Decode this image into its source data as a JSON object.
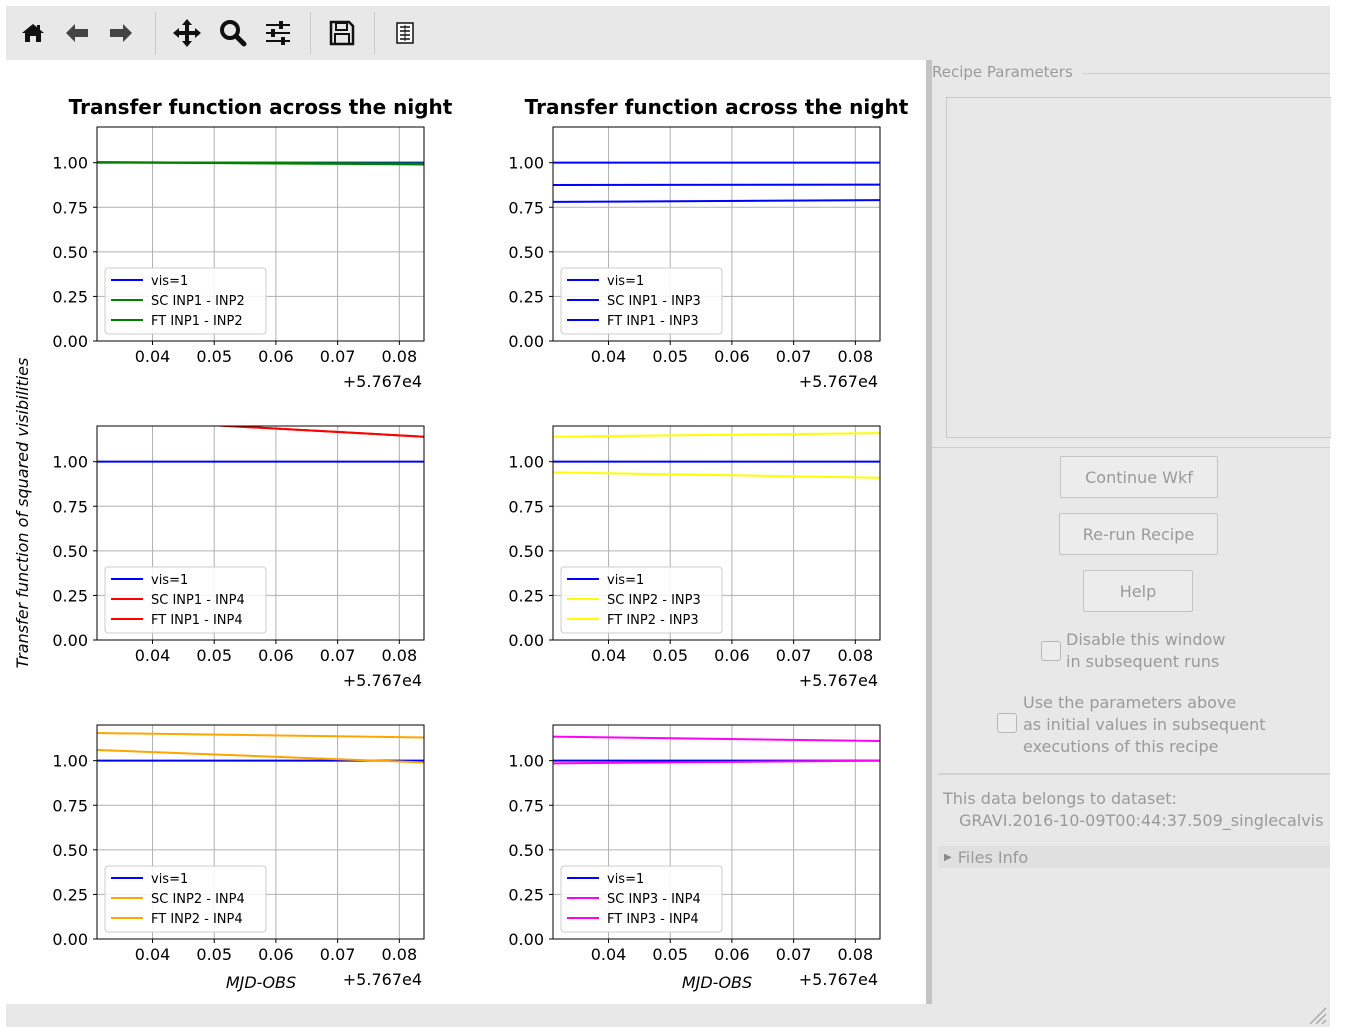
{
  "toolbar": {
    "buttons": [
      {
        "icon": "home-icon",
        "tooltip": "Home"
      },
      {
        "icon": "back-arrow-icon",
        "tooltip": "Back"
      },
      {
        "icon": "forward-arrow-icon",
        "tooltip": "Forward"
      },
      {
        "icon": "pan-icon",
        "tooltip": "Pan"
      },
      {
        "icon": "zoom-icon",
        "tooltip": "Zoom"
      },
      {
        "icon": "subplots-config-icon",
        "tooltip": "Configure subplots"
      },
      {
        "icon": "save-icon",
        "tooltip": "Save"
      },
      {
        "icon": "edit-parameters-icon",
        "tooltip": "Edit"
      }
    ]
  },
  "chart_data": [
    {
      "type": "line",
      "title": "Transfer function across the night",
      "x_offset_label": "+5.767e4",
      "x_tick_labels": [
        "0.04",
        "0.05",
        "0.06",
        "0.07",
        "0.08"
      ],
      "xlim": [
        0.031,
        0.084
      ],
      "ylim": [
        0,
        1.2
      ],
      "y_tick_labels": [
        "0.00",
        "0.25",
        "0.50",
        "0.75",
        "1.00"
      ],
      "legend_loc": "lower left",
      "series": [
        {
          "name": "vis=1",
          "color": "#0000ff",
          "x": [
            0.031,
            0.084
          ],
          "y": [
            1.0,
            1.0
          ]
        },
        {
          "name": "SC INP1 - INP2",
          "color": "#008000",
          "x": [
            0.031,
            0.084
          ],
          "y": [
            1.003,
            0.995
          ]
        },
        {
          "name": "FT INP1 - INP2",
          "color": "#008000",
          "x": [
            0.031,
            0.084
          ],
          "y": [
            1.002,
            0.99
          ]
        }
      ]
    },
    {
      "type": "line",
      "title": "Transfer function across the night",
      "x_offset_label": "+5.767e4",
      "x_tick_labels": [
        "0.04",
        "0.05",
        "0.06",
        "0.07",
        "0.08"
      ],
      "xlim": [
        0.031,
        0.084
      ],
      "ylim": [
        0,
        1.2
      ],
      "y_tick_labels": [
        "0.00",
        "0.25",
        "0.50",
        "0.75",
        "1.00"
      ],
      "legend_loc": "lower left",
      "series": [
        {
          "name": "vis=1",
          "color": "#0000ff",
          "x": [
            0.031,
            0.084
          ],
          "y": [
            1.0,
            1.0
          ]
        },
        {
          "name": "SC INP1 - INP3",
          "color": "#0000ff",
          "x": [
            0.031,
            0.084
          ],
          "y": [
            0.875,
            0.877
          ]
        },
        {
          "name": "FT INP1 - INP3",
          "color": "#0000ff",
          "x": [
            0.031,
            0.084
          ],
          "y": [
            0.78,
            0.79
          ]
        }
      ]
    },
    {
      "type": "line",
      "x_offset_label": "+5.767e4",
      "x_tick_labels": [
        "0.04",
        "0.05",
        "0.06",
        "0.07",
        "0.08"
      ],
      "xlim": [
        0.031,
        0.084
      ],
      "ylim": [
        0,
        1.2
      ],
      "y_tick_labels": [
        "0.00",
        "0.25",
        "0.50",
        "0.75",
        "1.00"
      ],
      "ylabel": "Transfer function of squared visibilities",
      "legend_loc": "lower left",
      "series": [
        {
          "name": "vis=1",
          "color": "#0000ff",
          "x": [
            0.031,
            0.084
          ],
          "y": [
            1.0,
            1.0
          ]
        },
        {
          "name": "SC INP1 - INP4",
          "color": "#ff0000",
          "x": [
            0.031,
            0.084
          ],
          "y": [
            1.24,
            1.14
          ]
        },
        {
          "name": "FT INP1 - INP4",
          "color": "#ff0000",
          "x": [
            0.031,
            0.084
          ],
          "y": [
            1.24,
            1.14
          ]
        }
      ]
    },
    {
      "type": "line",
      "x_offset_label": "+5.767e4",
      "x_tick_labels": [
        "0.04",
        "0.05",
        "0.06",
        "0.07",
        "0.08"
      ],
      "xlim": [
        0.031,
        0.084
      ],
      "ylim": [
        0,
        1.2
      ],
      "y_tick_labels": [
        "0.00",
        "0.25",
        "0.50",
        "0.75",
        "1.00"
      ],
      "legend_loc": "lower left",
      "series": [
        {
          "name": "vis=1",
          "color": "#0000ff",
          "x": [
            0.031,
            0.084
          ],
          "y": [
            1.0,
            1.0
          ]
        },
        {
          "name": "SC INP2 - INP3",
          "color": "#ffff00",
          "x": [
            0.031,
            0.084
          ],
          "y": [
            1.14,
            1.16
          ]
        },
        {
          "name": "FT INP2 - INP3",
          "color": "#ffff00",
          "x": [
            0.031,
            0.084
          ],
          "y": [
            0.94,
            0.91
          ]
        }
      ]
    },
    {
      "type": "line",
      "x_offset_label": "+5.767e4",
      "xlabel": "MJD-OBS",
      "x_tick_labels": [
        "0.04",
        "0.05",
        "0.06",
        "0.07",
        "0.08"
      ],
      "xlim": [
        0.031,
        0.084
      ],
      "ylim": [
        0,
        1.2
      ],
      "y_tick_labels": [
        "0.00",
        "0.25",
        "0.50",
        "0.75",
        "1.00"
      ],
      "legend_loc": "lower left",
      "series": [
        {
          "name": "vis=1",
          "color": "#0000ff",
          "x": [
            0.031,
            0.084
          ],
          "y": [
            1.0,
            1.0
          ]
        },
        {
          "name": "SC INP2 - INP4",
          "color": "#ffa500",
          "x": [
            0.031,
            0.084
          ],
          "y": [
            1.155,
            1.13
          ]
        },
        {
          "name": "FT INP2 - INP4",
          "color": "#ffa500",
          "x": [
            0.031,
            0.084
          ],
          "y": [
            1.06,
            0.99
          ]
        }
      ]
    },
    {
      "type": "line",
      "x_offset_label": "+5.767e4",
      "xlabel": "MJD-OBS",
      "x_tick_labels": [
        "0.04",
        "0.05",
        "0.06",
        "0.07",
        "0.08"
      ],
      "xlim": [
        0.031,
        0.084
      ],
      "ylim": [
        0,
        1.2
      ],
      "y_tick_labels": [
        "0.00",
        "0.25",
        "0.50",
        "0.75",
        "1.00"
      ],
      "legend_loc": "lower left",
      "series": [
        {
          "name": "vis=1",
          "color": "#0000ff",
          "x": [
            0.031,
            0.084
          ],
          "y": [
            1.0,
            1.0
          ]
        },
        {
          "name": "SC INP3 - INP4",
          "color": "#ff00ff",
          "x": [
            0.031,
            0.084
          ],
          "y": [
            1.135,
            1.11
          ]
        },
        {
          "name": "FT INP3 - INP4",
          "color": "#ff00ff",
          "x": [
            0.031,
            0.084
          ],
          "y": [
            0.985,
            1.0
          ]
        }
      ]
    }
  ],
  "panel": {
    "params_legend": "Recipe Parameters",
    "continue_label": "Continue Wkf",
    "rerun_label": "Re-run Recipe",
    "help_label": "Help",
    "disable_line1": "Disable this window",
    "disable_line2": "in subsequent runs",
    "use_line1": "Use the parameters above",
    "use_line2": "as initial values in subsequent",
    "use_line3": "executions of this recipe",
    "dataset_title": "This data belongs to dataset:",
    "dataset_name": "GRAVI.2016-10-09T00:44:37.509_singlecalvis",
    "files_info": "Files Info"
  }
}
